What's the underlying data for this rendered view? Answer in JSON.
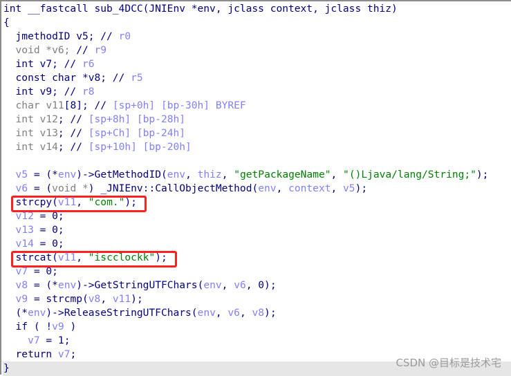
{
  "colors": {
    "keyword": "#000080",
    "variable": "#8080ff",
    "muted": "#808080",
    "string": "#008000",
    "highlight": "#ff2020"
  },
  "code_lines": [
    [
      [
        "int __fastcall sub_4DCC(JNIEnv *env, jclass context, jclass thiz)",
        "n"
      ]
    ],
    [
      [
        "{",
        "n"
      ]
    ],
    [
      [
        "  jmethodID v5; // ",
        "n"
      ],
      [
        "r0",
        "v"
      ]
    ],
    [
      [
        "  void *v6; ",
        "g"
      ],
      [
        "// ",
        "n"
      ],
      [
        "r9",
        "v"
      ]
    ],
    [
      [
        "  int v7; // ",
        "n"
      ],
      [
        "r6",
        "v"
      ]
    ],
    [
      [
        "  const char *v8; // ",
        "n"
      ],
      [
        "r5",
        "v"
      ]
    ],
    [
      [
        "  int v9; // ",
        "n"
      ],
      [
        "r8",
        "v"
      ]
    ],
    [
      [
        "  char v11",
        "g"
      ],
      [
        "[8]; // ",
        "n"
      ],
      [
        "[sp+0h] [bp-30h] BYREF",
        "v"
      ]
    ],
    [
      [
        "  int v12",
        "g"
      ],
      [
        "; // ",
        "n"
      ],
      [
        "[sp+8h] [bp-28h]",
        "v"
      ]
    ],
    [
      [
        "  int v13",
        "g"
      ],
      [
        "; // ",
        "n"
      ],
      [
        "[sp+Ch] [bp-24h]",
        "v"
      ]
    ],
    [
      [
        "  int v14",
        "g"
      ],
      [
        "; // ",
        "n"
      ],
      [
        "[sp+10h] [bp-20h]",
        "v"
      ]
    ],
    [
      [
        "",
        "n"
      ]
    ],
    [
      [
        "  ",
        "n"
      ],
      [
        "v5",
        "v"
      ],
      [
        " = (*",
        "n"
      ],
      [
        "env",
        "v"
      ],
      [
        ")->GetMethodID(",
        "n"
      ],
      [
        "env",
        "v"
      ],
      [
        ", ",
        "n"
      ],
      [
        "thiz",
        "v"
      ],
      [
        ", ",
        "n"
      ],
      [
        "\"getPackageName\"",
        "s"
      ],
      [
        ", ",
        "n"
      ],
      [
        "\"()Ljava/lang/String;\"",
        "s"
      ],
      [
        ");",
        "n"
      ]
    ],
    [
      [
        "  ",
        "n"
      ],
      [
        "v6",
        "v"
      ],
      [
        " = (",
        "n"
      ],
      [
        "void *",
        "g"
      ],
      [
        ") _JNIEnv::CallObjectMethod(",
        "n"
      ],
      [
        "env",
        "v"
      ],
      [
        ", ",
        "n"
      ],
      [
        "context",
        "v"
      ],
      [
        ", ",
        "n"
      ],
      [
        "v5",
        "v"
      ],
      [
        ");",
        "n"
      ]
    ],
    [
      [
        "  strcpy(",
        "n"
      ],
      [
        "v11",
        "v"
      ],
      [
        ", ",
        "n"
      ],
      [
        "\"com.\"",
        "s"
      ],
      [
        ");",
        "n"
      ]
    ],
    [
      [
        "  ",
        "n"
      ],
      [
        "v12",
        "v"
      ],
      [
        " = 0;",
        "n"
      ]
    ],
    [
      [
        "  ",
        "n"
      ],
      [
        "v13",
        "v"
      ],
      [
        " = 0;",
        "n"
      ]
    ],
    [
      [
        "  ",
        "n"
      ],
      [
        "v14",
        "v"
      ],
      [
        " = 0;",
        "n"
      ]
    ],
    [
      [
        "  strcat(",
        "n"
      ],
      [
        "v11",
        "v"
      ],
      [
        ", ",
        "n"
      ],
      [
        "\"iscclockk\"",
        "s"
      ],
      [
        ");",
        "n"
      ]
    ],
    [
      [
        "  ",
        "n"
      ],
      [
        "v7",
        "v"
      ],
      [
        " = 0;",
        "n"
      ]
    ],
    [
      [
        "  ",
        "n"
      ],
      [
        "v8",
        "v"
      ],
      [
        " = (*",
        "n"
      ],
      [
        "env",
        "v"
      ],
      [
        ")->GetStringUTFChars(",
        "n"
      ],
      [
        "env",
        "v"
      ],
      [
        ", ",
        "n"
      ],
      [
        "v6",
        "v"
      ],
      [
        ", 0);",
        "n"
      ]
    ],
    [
      [
        "  ",
        "n"
      ],
      [
        "v9",
        "v"
      ],
      [
        " = strcmp(",
        "n"
      ],
      [
        "v8",
        "v"
      ],
      [
        ", ",
        "n"
      ],
      [
        "v11",
        "v"
      ],
      [
        ");",
        "n"
      ]
    ],
    [
      [
        "  (*",
        "n"
      ],
      [
        "env",
        "v"
      ],
      [
        ")->ReleaseStringUTFChars(",
        "n"
      ],
      [
        "env",
        "v"
      ],
      [
        ", ",
        "n"
      ],
      [
        "v6",
        "v"
      ],
      [
        ", ",
        "n"
      ],
      [
        "v8",
        "v"
      ],
      [
        ");",
        "n"
      ]
    ],
    [
      [
        "  if ( !",
        "n"
      ],
      [
        "v9",
        "v"
      ],
      [
        " )",
        "n"
      ]
    ],
    [
      [
        "    ",
        "n"
      ],
      [
        "v7",
        "v"
      ],
      [
        " = 1;",
        "n"
      ]
    ],
    [
      [
        "  return ",
        "n"
      ],
      [
        "v7",
        "v"
      ],
      [
        ";",
        "n"
      ]
    ],
    [
      [
        "}",
        "n"
      ]
    ]
  ],
  "watermark": "CSDN @目标是技术宅"
}
